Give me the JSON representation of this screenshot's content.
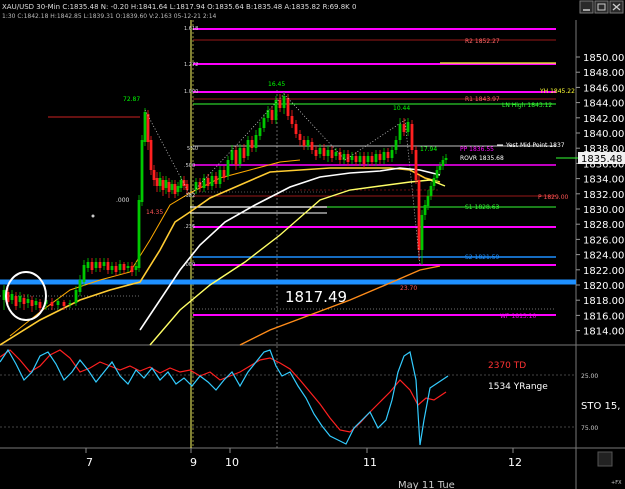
{
  "header": {
    "symbol_line": "XAU/USD  30-Min  C:1835.48  N: -0.20  H:1841.64  L:1817.94  O:1835.64  B:1835.48  A:1835.82  R:69.8K 0",
    "sub_line": "1:30  C:1842.18  H:1842.85  L:1839.31  O:1839.60  V:2.163  05-12-21  2:14"
  },
  "price_axis": {
    "ticks": [
      "1850.00",
      "1848.00",
      "1846.00",
      "1844.00",
      "1842.00",
      "1840.00",
      "1838.00",
      "1836.00",
      "1834.00",
      "1832.00",
      "1830.00",
      "1828.00",
      "1826.00",
      "1824.00",
      "1822.00",
      "1820.00",
      "1818.00",
      "1816.00",
      "1814.00"
    ],
    "current_price": "1835.48"
  },
  "fib_labels": [
    "1.618",
    "1.272",
    "1.000",
    ".618",
    ".500",
    ".382",
    ".236",
    ".000"
  ],
  "level_labels": {
    "r2": "R2  1852.27",
    "yh": "YH  1845.22",
    "r1": "R1  1843.97",
    "ln_high": "LN High  1843.12",
    "yest_mid": "Yest Mid Point 1837",
    "pp": "PP  1836.55",
    "rovr": "ROVR  1835.68",
    "p2": "P  1829.00",
    "s1": "S1  1828.63",
    "s2": "S2  1821.59",
    "wp": "WP  1813.10"
  },
  "point_labels": {
    "a": "72.87",
    "b": "16.45",
    "c": "10.44",
    "d": "14.35",
    "e": ".000",
    "f": "17.94",
    "g": "23.70",
    "h": "5%0"
  },
  "big_level": "1817.49",
  "oscillator": {
    "td_text": "2370 TD",
    "yrange_text": "1534 YRange",
    "sto_text": "STO  15,",
    "ticks": [
      "25.00",
      "75.00"
    ]
  },
  "time_axis": {
    "labels": [
      "7",
      "9",
      "10",
      "11",
      "12"
    ],
    "bottom_label": "May 11 Tue",
    "corner": "+FX"
  },
  "colors": {
    "background": "#000000",
    "magenta": "#ff00ff",
    "green_level": "#33ff33",
    "blue_level": "#1e90ff",
    "candle_up": "#00c800",
    "candle_down": "#ff2020",
    "osc_cyan": "#33ccff",
    "osc_red": "#ff2020"
  },
  "icons": [
    "minimize-icon",
    "maximize-icon",
    "close-icon"
  ]
}
